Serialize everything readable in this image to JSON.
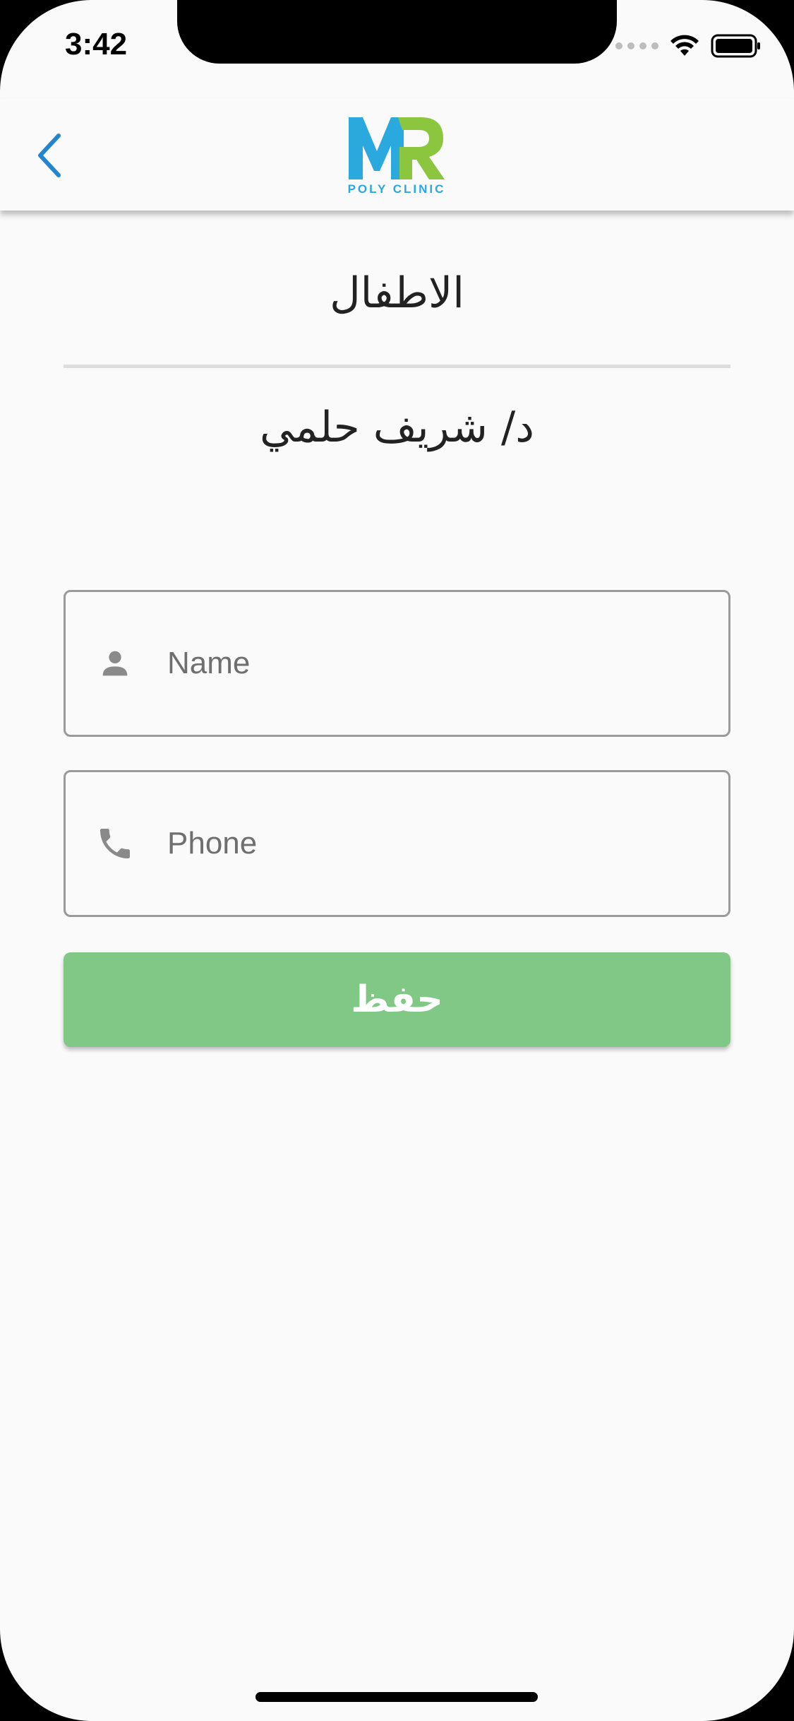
{
  "status_bar": {
    "time": "3:42",
    "icons": [
      "signal-icon",
      "wifi-icon",
      "battery-icon"
    ]
  },
  "app_bar": {
    "back_icon": "chevron-left-icon",
    "logo": {
      "letters": "MR",
      "subtitle": "POLY CLINIC",
      "colors": {
        "blue": "#2aa9df",
        "green": "#8cc63f"
      }
    }
  },
  "main": {
    "specialty": "الاطفال",
    "doctor": "د/ شريف حلمي"
  },
  "form": {
    "name_placeholder": "Name",
    "name_value": "",
    "phone_placeholder": "Phone",
    "phone_value": "",
    "save_label": "حفظ"
  },
  "colors": {
    "accent": "#2185d0",
    "button": "#81c887",
    "background": "#fafafa",
    "icon_gray": "#8a8a8a"
  }
}
